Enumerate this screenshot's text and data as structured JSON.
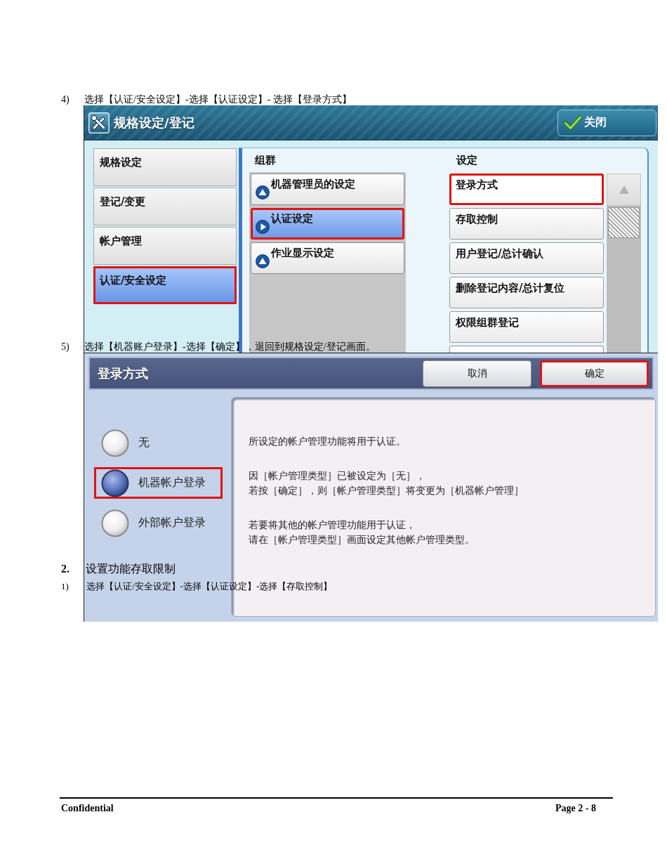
{
  "step_4": {
    "number": "4)",
    "instruction": "选择【认证/安全设定】-选择【认证设定】- 选择【登录方式】"
  },
  "screen_1": {
    "title": "规格设定/登记",
    "close_button": "关闭",
    "categories": [
      {
        "label": "规格设定",
        "selected": false,
        "highlighted": false
      },
      {
        "label": "登记/变更",
        "selected": false,
        "highlighted": false
      },
      {
        "label": "帐户管理",
        "selected": false,
        "highlighted": false
      },
      {
        "label": "认证/安全设定",
        "selected": true,
        "highlighted": true
      }
    ],
    "group_heading": "组群",
    "settings_heading": "设定",
    "groups": [
      {
        "label": "机器管理员的设定",
        "selected": false,
        "highlighted": false
      },
      {
        "label": "认证设定",
        "selected": true,
        "highlighted": true
      },
      {
        "label": "作业显示设定",
        "selected": false,
        "highlighted": false
      }
    ],
    "settings": [
      {
        "label": "登录方式",
        "highlighted": true
      },
      {
        "label": "存取控制",
        "highlighted": false
      },
      {
        "label": "用户登记/总计确认",
        "highlighted": false
      },
      {
        "label": "删除登记内容/总计复位",
        "highlighted": false
      },
      {
        "label": "权限组群登记",
        "highlighted": false
      }
    ]
  },
  "step_5": {
    "number": "5)",
    "instruction": "选择【机器账户登录】-选择【确定】，退回到规格设定/登记画面。"
  },
  "screen_2": {
    "title": "登录方式",
    "buttons": [
      {
        "label": "取消",
        "highlighted": false
      },
      {
        "label": "确定",
        "highlighted": true
      }
    ],
    "options": [
      {
        "label": "无",
        "selected": false,
        "highlighted": false
      },
      {
        "label": "机器帐户登录",
        "selected": true,
        "highlighted": true
      },
      {
        "label": "外部帐户登录",
        "selected": false,
        "highlighted": false
      }
    ],
    "messages": [
      [
        "所设定的帐户管理功能将用于认证。"
      ],
      [
        "因［帐户管理类型］已被设定为［无］，",
        "若按［确定］，则［帐户管理类型］将变更为［机器帐户管理］"
      ],
      [
        "若要将其他的帐户管理功能用于认证，",
        "请在［帐户管理类型］画面设定其他帐户管理类型。"
      ]
    ]
  },
  "section_2": {
    "number": "2.",
    "title": "设置功能存取限制"
  },
  "step_1": {
    "number": "1)",
    "instruction": "选择【认证/安全设定】-选择【认证设定】-选择【存取控制】"
  },
  "footer": {
    "left": "Confidential",
    "right": "Page 2 - 8"
  }
}
